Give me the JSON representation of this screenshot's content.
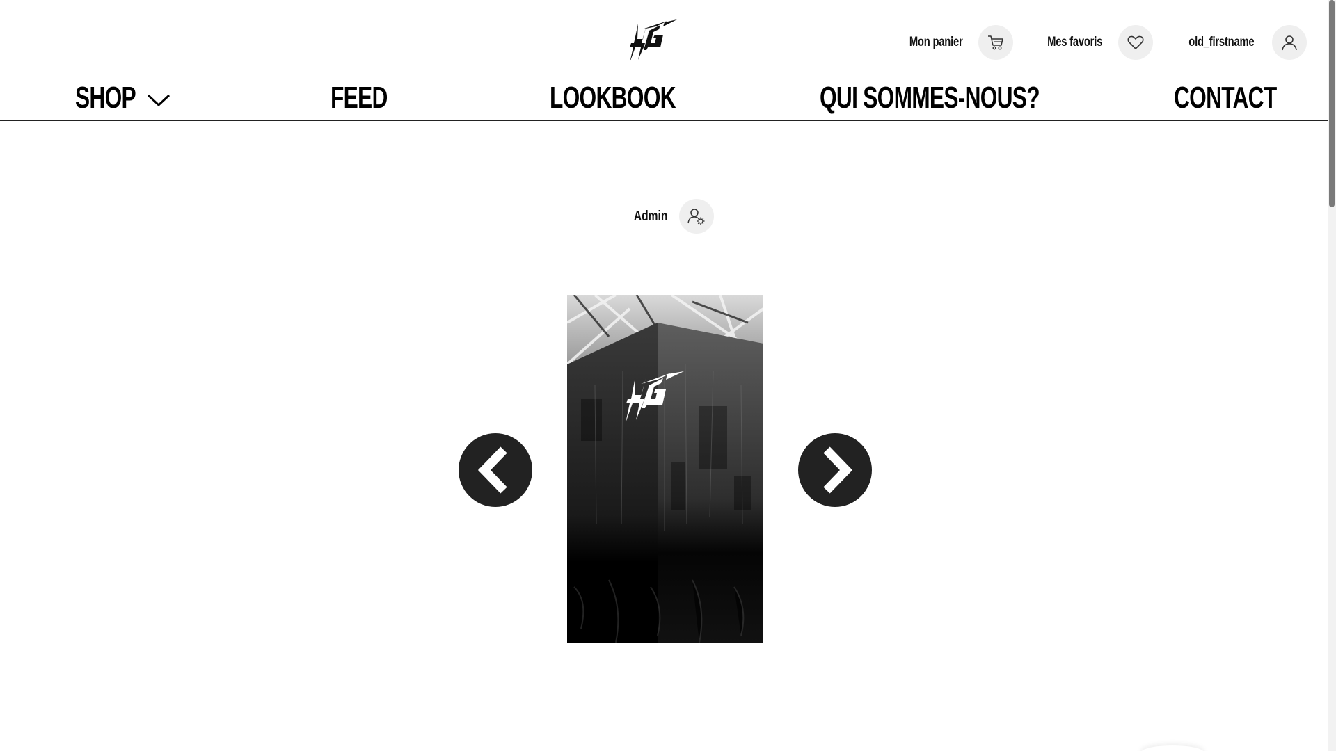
{
  "header": {
    "logo_alt": "HG",
    "cart_label": "Mon panier",
    "favorites_label": "Mes favoris",
    "user_label": "old_firstname"
  },
  "nav": {
    "items": [
      {
        "label": "SHOP",
        "has_dropdown": true
      },
      {
        "label": "FEED"
      },
      {
        "label": "LOOKBOOK"
      },
      {
        "label": "QUI SOMMES-NOUS?"
      },
      {
        "label": "CONTACT"
      }
    ]
  },
  "admin": {
    "label": "Admin",
    "icon": "user-gear-icon"
  },
  "carousel": {
    "prev_icon": "chevron-left-icon",
    "next_icon": "chevron-right-icon",
    "image_logo": "HG"
  },
  "colors": {
    "text": "#111111",
    "circle_bg": "#efefef",
    "arrow_bg": "#222222",
    "border": "#222222"
  }
}
